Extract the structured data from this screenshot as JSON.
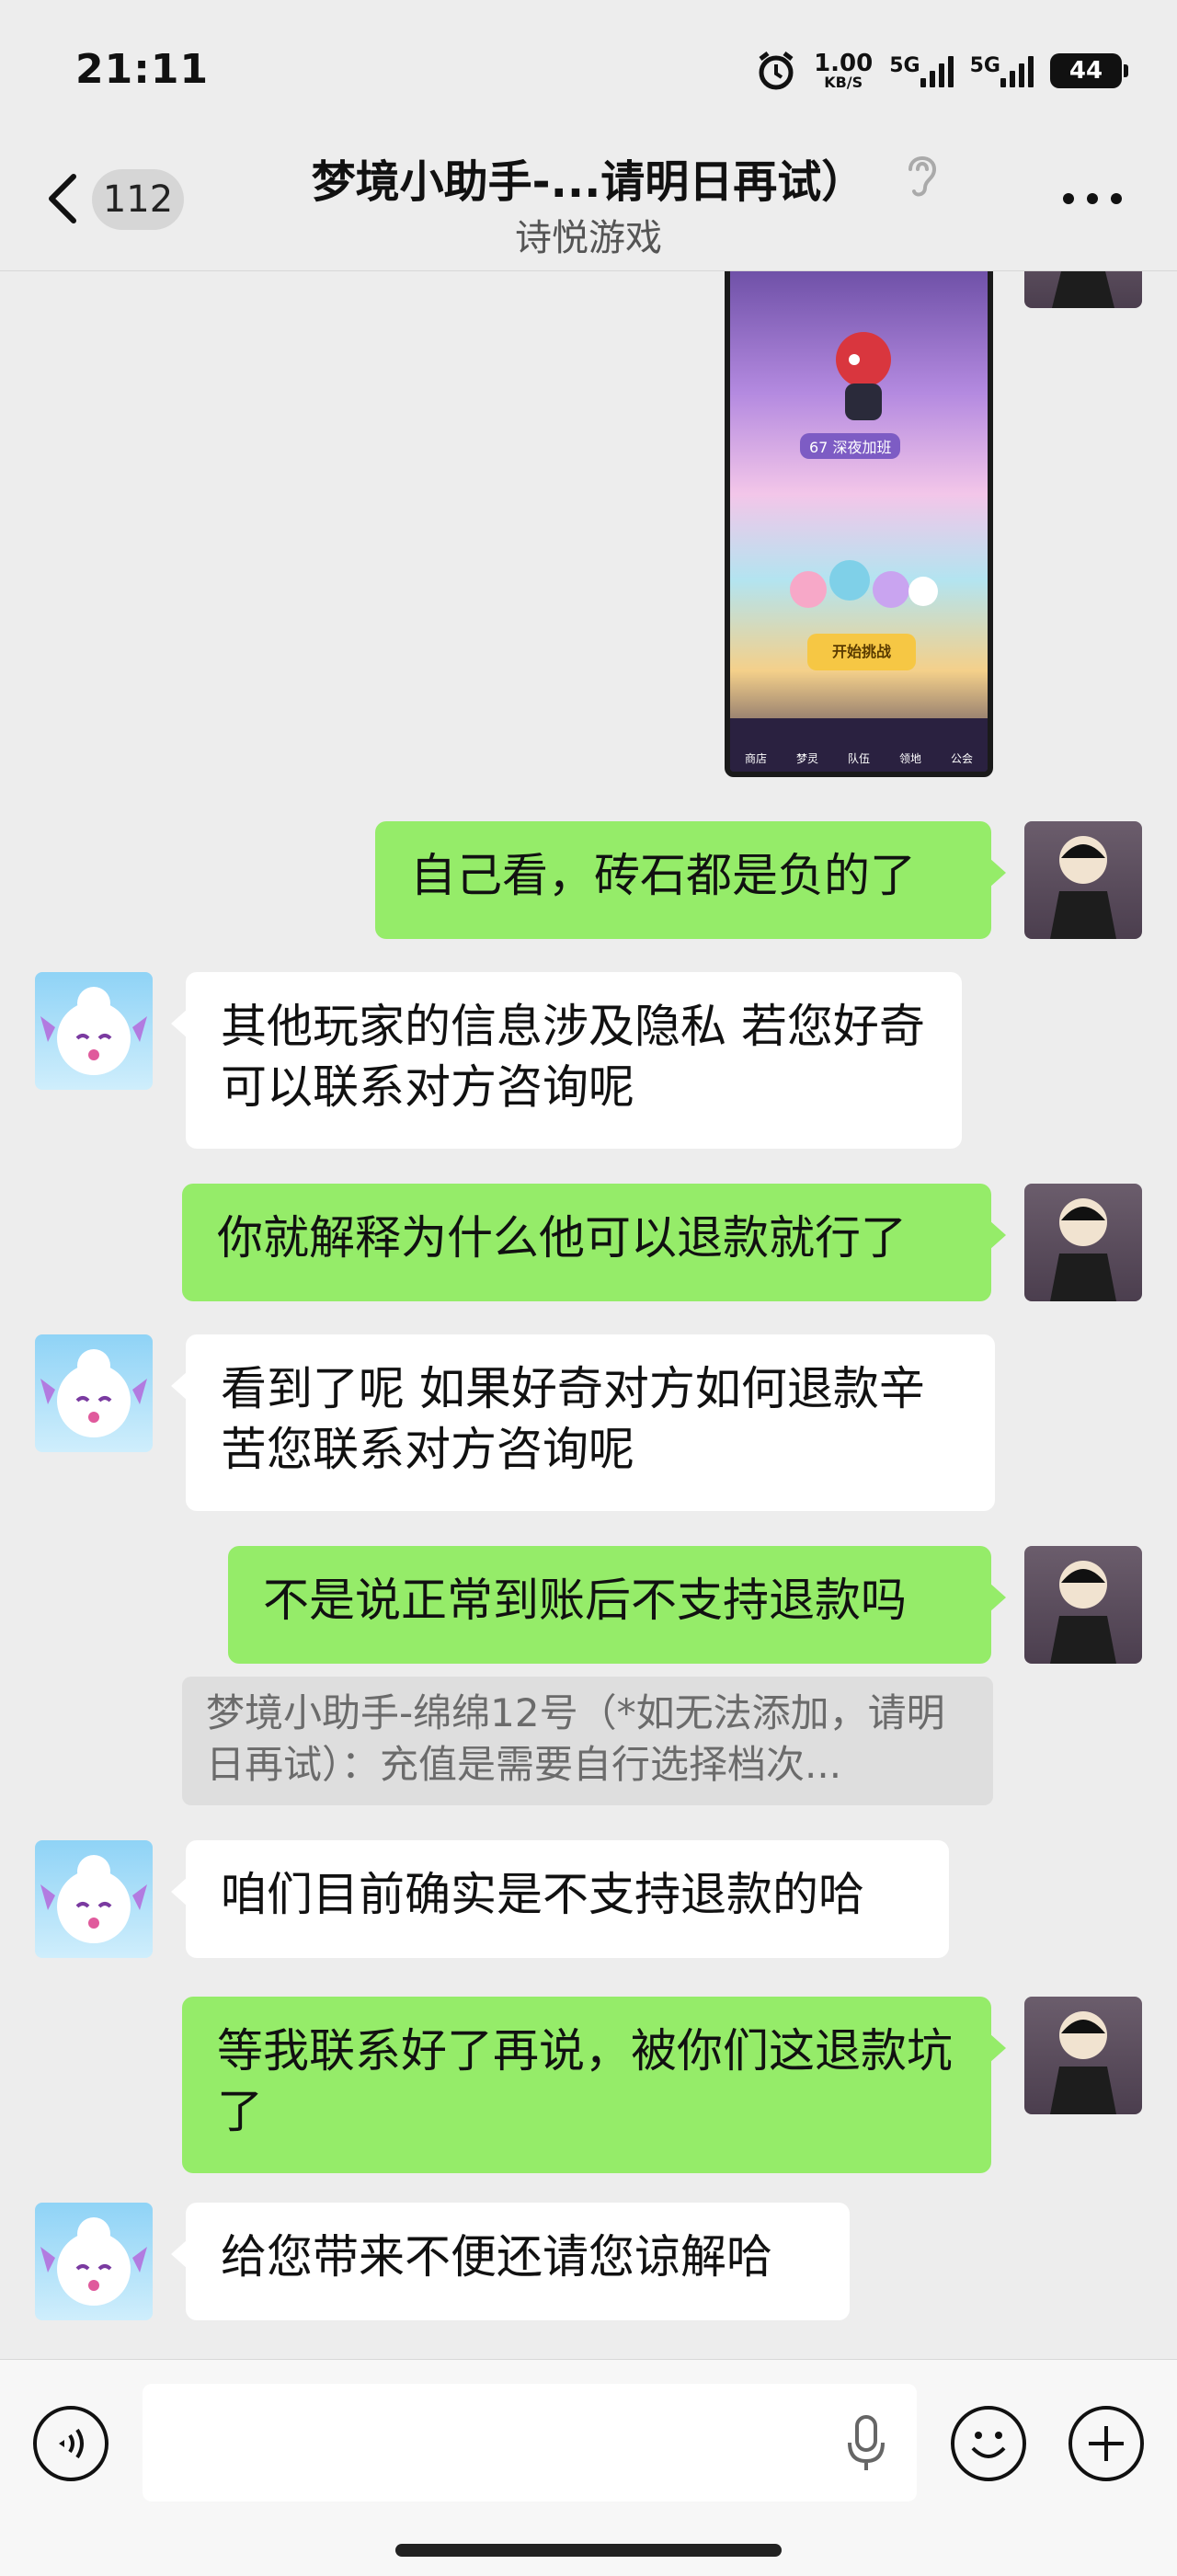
{
  "status_bar": {
    "time": "21:11",
    "net_speed_value": "1.00",
    "net_speed_unit": "KB/S",
    "network1": "5G",
    "network2": "5G",
    "battery": "44"
  },
  "header": {
    "unread_count": "112",
    "title": "梦境小助手-...请明日再试）",
    "subtitle": "诗悦游戏"
  },
  "screenshot_preview": {
    "tag": "67 深夜加班",
    "button": "开始挑战",
    "nav": [
      "商店",
      "梦灵",
      "队伍",
      "领地",
      "公会"
    ]
  },
  "messages": [
    {
      "side": "me",
      "text": "自己看，砖石都是负的了"
    },
    {
      "side": "bot",
      "text": "其他玩家的信息涉及隐私 若您好奇 可以联系对方咨询呢"
    },
    {
      "side": "me",
      "text": "你就解释为什么他可以退款就行了"
    },
    {
      "side": "bot",
      "text": "看到了呢 如果好奇对方如何退款辛苦您联系对方咨询呢"
    },
    {
      "side": "me",
      "text": "不是说正常到账后不支持退款吗"
    },
    {
      "side": "bot",
      "text": "咱们目前确实是不支持退款的哈"
    },
    {
      "side": "me",
      "text": "等我联系好了再说，被你们这退款坑了"
    },
    {
      "side": "bot",
      "text": "给您带来不便还请您谅解哈"
    }
  ],
  "quote": {
    "text": "梦境小助手-绵绵12号（*如无法添加，请明日再试）：充值是需要自行选择档次..."
  },
  "colors": {
    "background": "#ededed",
    "my_bubble": "#95ec69",
    "their_bubble": "#ffffff"
  },
  "icons": [
    "back-arrow-icon",
    "ear-icon",
    "more-icon",
    "voice-icon",
    "mic-icon",
    "emoji-icon",
    "plus-icon"
  ]
}
